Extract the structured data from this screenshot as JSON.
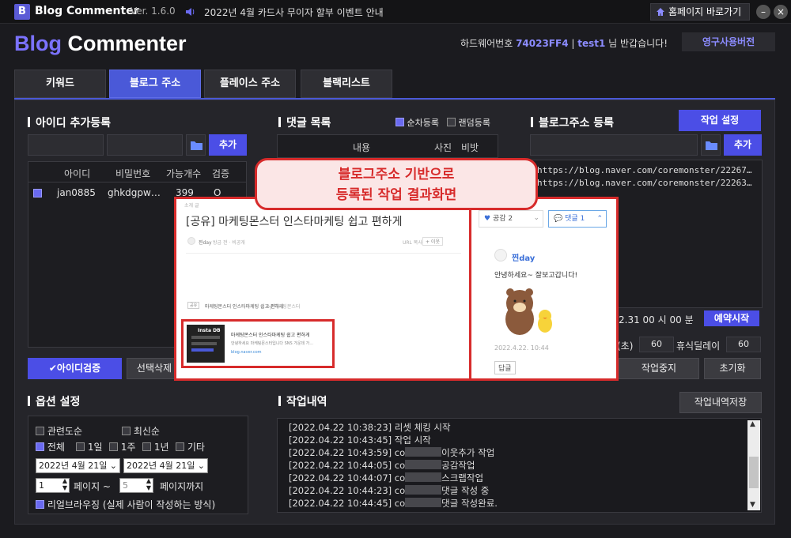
{
  "titlebar": {
    "app_icon": "B",
    "title": "Blog Commenter",
    "version": "Ver. 1.6.0",
    "notice": "2022년 4월 카드사 무이자 할부 이벤트 안내",
    "homepage_btn": "홈페이지 바로가기"
  },
  "header": {
    "logo_blog": "Blog",
    "logo_rest": " Commenter",
    "hw_label": "하드웨어번호 ",
    "hw_value": "74023FF4",
    "sep": " | ",
    "user": "test1",
    "greeting": " 님 반갑습니다!",
    "license_btn": "영구사용버전"
  },
  "tabs": [
    {
      "label": "키워드"
    },
    {
      "label": "블로그 주소"
    },
    {
      "label": "플레이스 주소"
    },
    {
      "label": "블랙리스트"
    }
  ],
  "id_section": {
    "title": "아이디 추가등록",
    "add_btn": "추가",
    "columns": [
      "아이디",
      "비밀번호",
      "가능개수",
      "검증"
    ],
    "rows": [
      {
        "id": "jan0885",
        "pw": "ghkdgpw…",
        "count": "399",
        "verify": "O"
      }
    ],
    "verify_btn": "아이디검증",
    "delete_btn": "선택삭제"
  },
  "comment_section": {
    "title": "댓글 목록",
    "opt_sequential": "순차등록",
    "opt_random": "랜덤등록",
    "columns": [
      "내용",
      "사진",
      "비밧"
    ]
  },
  "blog_section": {
    "title": "블로그주소 등록",
    "settings_btn": "작업 설정",
    "add_btn": "추가",
    "urls": [
      "https://blog.naver.com/coremonster/22267…",
      "https://blog.naver.com/coremonster/22263…"
    ],
    "time_prefix": "2.31",
    "time_hour": "00",
    "hour_unit": "시",
    "time_min": "00",
    "min_unit": "분",
    "reserve_btn": "예약시작",
    "delay_suffix": "(초)",
    "delay_value": "60",
    "rest_label": "휴식딜레이",
    "rest_value": "60",
    "stop_btn": "작업중지",
    "reset_btn": "초기화"
  },
  "options": {
    "title": "옵션 설정",
    "sort_related": "관련도순",
    "sort_recent": "최신순",
    "periods": [
      "전체",
      "1일",
      "1주",
      "1년",
      "기타"
    ],
    "date_from": "2022년   4월 21일",
    "date_to": "2022년   4월 21일",
    "page_from": "1",
    "page_from_label": "페이지 ~",
    "page_to": "5",
    "page_to_label": "페이지까지",
    "real_browsing": "리얼브라우징 (실제 사람이 작성하는 방식)"
  },
  "log_section": {
    "title": "작업내역",
    "save_btn": "작업내역저장",
    "lines": [
      {
        "time": "[2022.04.22 10:38:23]",
        "msg": "리셋 체킹 시작",
        "masked": false
      },
      {
        "time": "[2022.04.22 10:43:45]",
        "msg": "작업 시작",
        "masked": false
      },
      {
        "time": "[2022.04.22 10:43:59]",
        "prefix": "co",
        "msg": "이웃추가 작업",
        "masked": true
      },
      {
        "time": "[2022.04.22 10:44:05]",
        "prefix": "co",
        "msg": "공감작업",
        "masked": true
      },
      {
        "time": "[2022.04.22 10:44:07]",
        "prefix": "co",
        "msg": "스크랩작업",
        "masked": true
      },
      {
        "time": "[2022.04.22 10:44:23]",
        "prefix": "co",
        "msg": "댓글 작성 중",
        "masked": true
      },
      {
        "time": "[2022.04.22 10:44:45]",
        "prefix": "co",
        "msg": "댓글 작성완료.",
        "masked": true
      }
    ]
  },
  "overlay": {
    "callout_line1": "블로그주소 기반으로",
    "callout_line2": "등록된 작업 결과화면",
    "post_category": "소개 글",
    "post_title": "[공유] 마케팅몬스터 인스타마케팅 쉽고 편하게",
    "post_author": "찐day",
    "post_meta": "방금 전 · 비공개",
    "url_copy": "URL 복사",
    "neighbor_btn": "+ 이웃",
    "share_tag": "공유",
    "share_title": "마케팅몬스터 인스타마케팅 쉽고 편하게",
    "share_by": "by 마케팅몬스터",
    "card_thumb_text": "Insta DB",
    "card_title": "마케팅몬스터 인스타마케팅 쉽고 편하게",
    "card_desc": "안녕하세요 마케팅몬스터입니다 SNS 가운데 가…",
    "card_url": "blog.naver.com",
    "like_label": "공감 2",
    "comment_label": "댓글 1",
    "commenter": "찐day",
    "comment_text": "안녕하세요~ 잘보고갑니다!",
    "comment_date": "2022.4.22. 10:44",
    "reply_btn": "답글"
  },
  "colors": {
    "accent": "#4b4ee6",
    "logo_blog": "#7b72ff",
    "highlight": "#d72b2b"
  }
}
